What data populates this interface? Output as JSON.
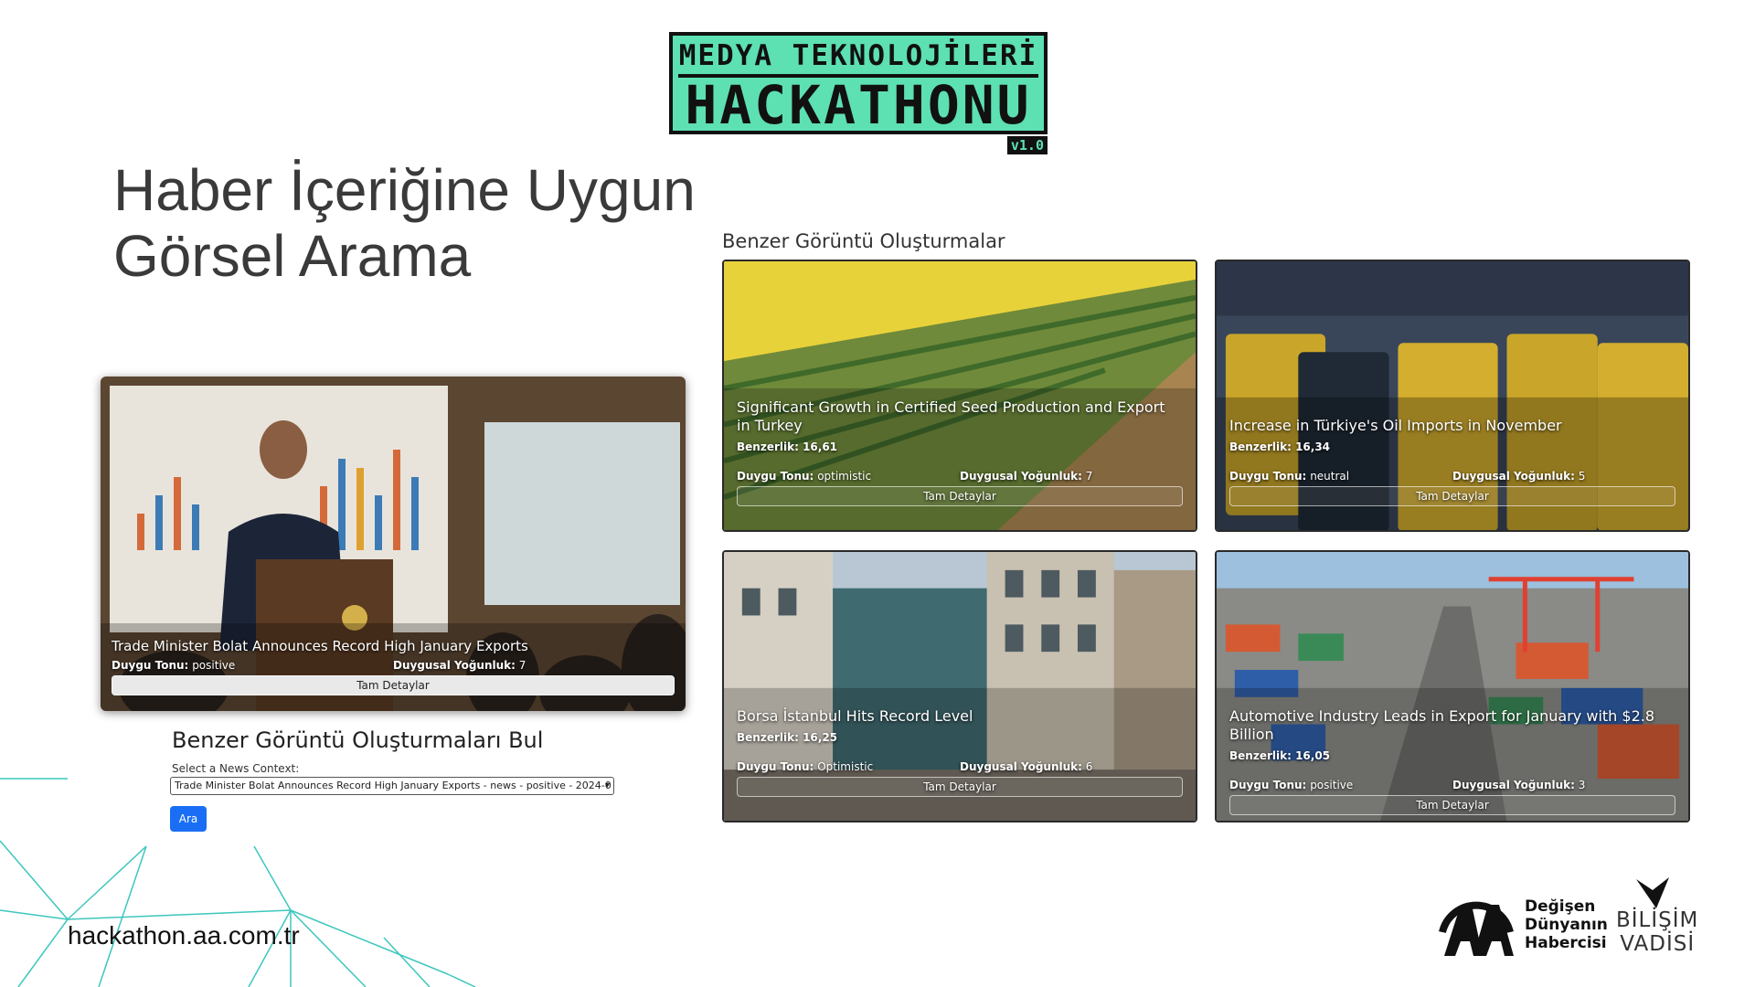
{
  "logo": {
    "line1": "MEDYA TEKNOLOJİLERİ",
    "line2": "HACKATHONU",
    "version": "v1.0"
  },
  "slide": {
    "title_line1": "Haber İçeriğine Uygun",
    "title_line2": "Görsel Arama"
  },
  "preview": {
    "title": "Trade Minister Bolat Announces Record High January Exports",
    "tone_label": "Duygu Tonu:",
    "tone_value": "positive",
    "intensity_label": "Duygusal Yoğunluk:",
    "intensity_value": "7",
    "detail_button": "Tam Detaylar"
  },
  "form": {
    "title": "Benzer Görüntü Oluşturmaları Bul",
    "label": "Select a News Context:",
    "selected": "Trade Minister Bolat Announces Record High January Exports - news - positive - 2024-0",
    "button": "Ara"
  },
  "results": {
    "heading": "Benzer Görüntü Oluşturmalar",
    "similarity_label": "Benzerlik:",
    "tone_label": "Duygu Tonu:",
    "intensity_label": "Duygusal Yoğunluk:",
    "detail_button": "Tam Detaylar",
    "cards": [
      {
        "title": "Significant Growth in Certified Seed Production and Export in Turkey",
        "similarity": "16,61",
        "tone": "optimistic",
        "intensity": "7"
      },
      {
        "title": "Increase in Türkiye's Oil Imports in November",
        "similarity": "16,34",
        "tone": "neutral",
        "intensity": "5"
      },
      {
        "title": "Borsa İstanbul Hits Record Level",
        "similarity": "16,25",
        "tone": "Optimistic",
        "intensity": "6"
      },
      {
        "title": "Automotive Industry Leads in Export for January with $2.8 Billion",
        "similarity": "16,05",
        "tone": "positive",
        "intensity": "3"
      }
    ]
  },
  "footer": {
    "url": "hackathon.aa.com.tr",
    "aa_line1": "Değişen",
    "aa_line2": "Dünyanın",
    "aa_line3": "Habercisi",
    "bv_line1": "BİLİŞİM",
    "bv_line2": "VADİSİ"
  },
  "colors": {
    "logo_green": "#5de0b2",
    "button_blue": "#1a6ef5",
    "deco_lines": "#3cc7bd"
  }
}
